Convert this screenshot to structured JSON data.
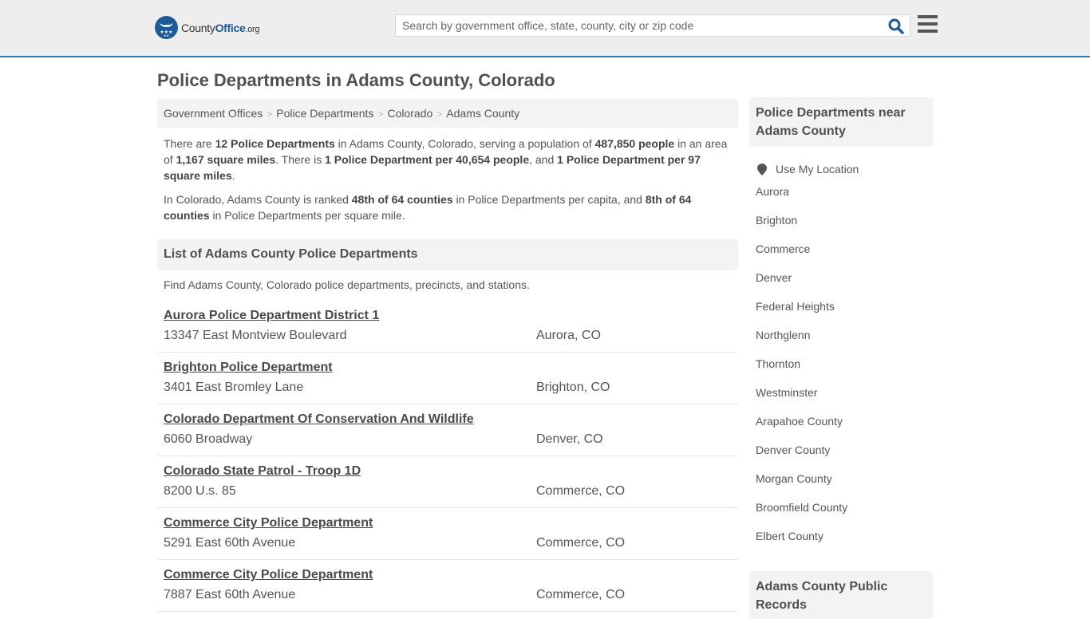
{
  "header": {
    "logo_main": "County",
    "logo_brand": "Office",
    "logo_tld": ".org",
    "search_placeholder": "Search by government office, state, county, city or zip code",
    "search_value": "",
    "search_icon": "search-icon",
    "menu_icon": "hamburger-menu-icon",
    "accent_color": "#2f7ab8"
  },
  "page": {
    "title": "Police Departments in Adams County, Colorado"
  },
  "breadcrumb": [
    {
      "label": "Government Offices"
    },
    {
      "label": "Police Departments"
    },
    {
      "label": "Colorado"
    },
    {
      "label": "Adams County"
    }
  ],
  "intro": {
    "p1": {
      "t1": "There are ",
      "b1": "12 Police Departments",
      "t2": " in Adams County, Colorado, serving a population of ",
      "b2": "487,850 people",
      "t3": " in an area of ",
      "b3": "1,167 square miles",
      "t4": ". There is ",
      "b4": "1 Police Department per 40,654 people",
      "t5": ", and ",
      "b5": "1 Police Department per 97 square miles",
      "t6": "."
    },
    "p2": {
      "t1": "In Colorado, Adams County is ranked ",
      "b1": "48th of 64 counties",
      "t2": " in Police Departments per capita, and ",
      "b2": "8th of 64 counties",
      "t3": " in Police Departments per square mile."
    }
  },
  "list": {
    "heading": "List of Adams County Police Departments",
    "description": "Find Adams County, Colorado police departments, precincts, and stations.",
    "items": [
      {
        "name": "Aurora Police Department District 1",
        "address": "13347 East Montview Boulevard",
        "city": "Aurora, CO"
      },
      {
        "name": "Brighton Police Department",
        "address": "3401 East Bromley Lane",
        "city": "Brighton, CO"
      },
      {
        "name": "Colorado Department Of Conservation And Wildlife",
        "address": "6060 Broadway",
        "city": "Denver, CO"
      },
      {
        "name": "Colorado State Patrol - Troop 1D",
        "address": "8200 U.s. 85",
        "city": "Commerce, CO"
      },
      {
        "name": "Commerce City Police Department",
        "address": "5291 East 60th Avenue",
        "city": "Commerce, CO"
      },
      {
        "name": "Commerce City Police Department",
        "address": "7887 East 60th Avenue",
        "city": "Commerce, CO"
      }
    ]
  },
  "sidebar": {
    "heading": "Police Departments near Adams County",
    "use_location": "Use My Location",
    "links": [
      "Aurora",
      "Brighton",
      "Commerce",
      "Denver",
      "Federal Heights",
      "Northglenn",
      "Thornton",
      "Westminster",
      "Arapahoe County",
      "Denver County",
      "Morgan County",
      "Broomfield County",
      "Elbert County"
    ],
    "heading2": "Adams County Public Records"
  }
}
